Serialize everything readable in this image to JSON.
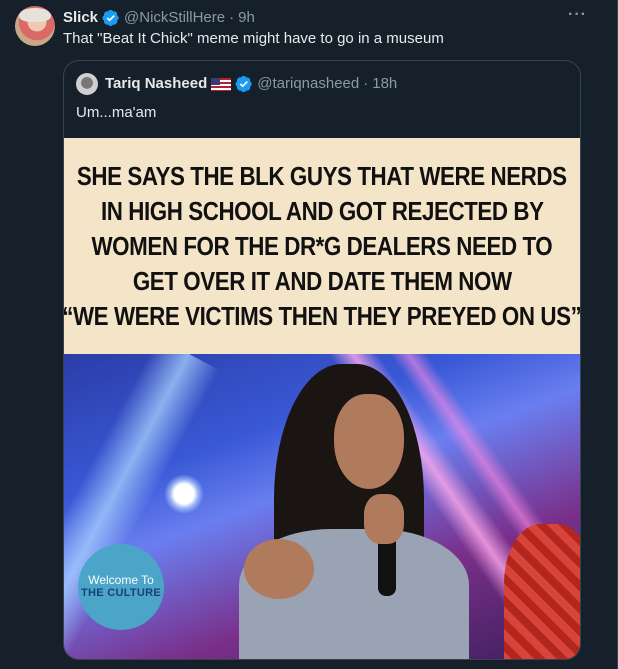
{
  "tweet": {
    "author_name": "Slick",
    "author_handle": "@NickStillHere",
    "separator": "·",
    "time": "9h",
    "text": "That \"Beat It Chick\" meme might have to go in a museum",
    "more_label": "···"
  },
  "quote": {
    "author_name": "Tariq Nasheed",
    "author_handle": "@tariqnasheed",
    "separator": "·",
    "time": "18h",
    "text": "Um...ma'am",
    "caption_lines": [
      "SHE SAYS THE BLK GUYS THAT WERE NERDS",
      "IN HIGH SCHOOL AND GOT REJECTED BY",
      "WOMEN FOR THE DR*G DEALERS NEED TO",
      "GET OVER IT AND DATE THEM NOW",
      "“WE WERE VICTIMS THEN THEY PREYED ON US”"
    ],
    "badge_line1": "Welcome To",
    "badge_line2": "THE CULTURE"
  },
  "colors": {
    "background": "#15202b",
    "verified": "#1d9bf0",
    "muted": "#8b98a5",
    "caption_bg": "#f4e4c8"
  },
  "icons": {
    "verified": "verified-badge-icon",
    "flag": "us-flag-icon",
    "more": "more-icon"
  }
}
